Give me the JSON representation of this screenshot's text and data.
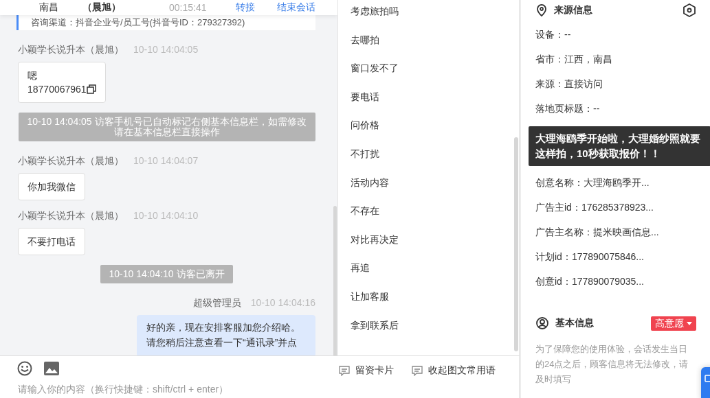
{
  "header": {
    "location": "南昌",
    "agent": "（晨旭）",
    "timer": "00:15:41",
    "actions": [
      "转接",
      "结束会话"
    ]
  },
  "channel_card": {
    "text": "咨询渠道：抖音企业号/员工号(抖音号ID：279327392)"
  },
  "messages": [
    {
      "kind": "incoming",
      "sender": "小颖学长说升本（晨旭）",
      "time": "10-10 14:04:05",
      "lines": [
        "嗯",
        "18770067961"
      ],
      "copy_icon": true
    },
    {
      "kind": "system",
      "text": "10-10 14:04:05 访客手机号已自动标记右侧基本信息栏，如需修改请在基本信息栏直接操作"
    },
    {
      "kind": "incoming",
      "sender": "小颖学长说升本（晨旭）",
      "time": "10-10 14:04:07",
      "lines": [
        "你加我微信"
      ],
      "copy_icon": false
    },
    {
      "kind": "incoming",
      "sender": "小颖学长说升本（晨旭）",
      "time": "10-10 14:04:10",
      "lines": [
        "不要打电话"
      ],
      "copy_icon": false
    },
    {
      "kind": "system",
      "text": "10-10 14:04:10 访客已离开"
    },
    {
      "kind": "outgoing",
      "sender": "超级管理员",
      "time": "10-10 14:04:16",
      "lines": [
        "好的亲，现在安排客服加您介绍哈。请您稍后注意查看一下“通讯录”并点"
      ],
      "copy_icon": false
    }
  ],
  "phrases": [
    "考虑旅拍吗",
    "去哪拍",
    "窗口发不了",
    "要电话",
    "问价格",
    "不打扰",
    "活动内容",
    "不存在",
    "对比再决定",
    "再追",
    "让加客服",
    "拿到联系后"
  ],
  "composer": {
    "placeholder": "请输入你的内容（换行快捷键：shift/ctrl + enter）",
    "actions": [
      "留资卡片",
      "收起图文常用语"
    ]
  },
  "source_info": {
    "title": "来源信息",
    "rows": [
      "设备：--",
      "省市：江西，南昌",
      "来源：直接访问",
      "落地页标题：--",
      "创意名称：大理海鸥季开...",
      "广告主id：176285378923...",
      "广告主名称：提米映画信息...",
      "计划id：177890075846...",
      "创意id：177890079035..."
    ]
  },
  "tooltip": {
    "text": "大理海鸥季开始啦，大理婚纱照就要这样拍，10秒获取报价！！"
  },
  "basic_info": {
    "title": "基本信息",
    "intent": "高意愿",
    "note": "为了保障您的使用体验，会话发生当日的24点之后，顾客信息将无法修改，请及时填写"
  }
}
